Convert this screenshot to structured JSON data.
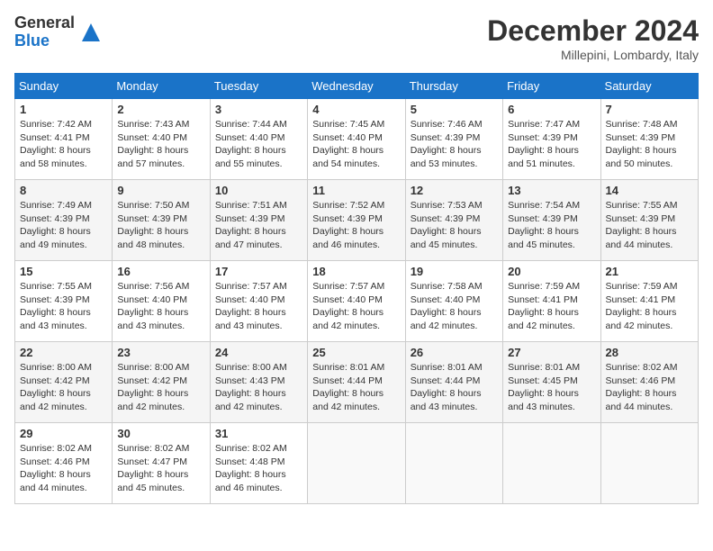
{
  "logo": {
    "general": "General",
    "blue": "Blue"
  },
  "title": "December 2024",
  "location": "Millepini, Lombardy, Italy",
  "days_of_week": [
    "Sunday",
    "Monday",
    "Tuesday",
    "Wednesday",
    "Thursday",
    "Friday",
    "Saturday"
  ],
  "weeks": [
    [
      {
        "day": "1",
        "sunrise": "7:42 AM",
        "sunset": "4:41 PM",
        "daylight": "8 hours and 58 minutes."
      },
      {
        "day": "2",
        "sunrise": "7:43 AM",
        "sunset": "4:40 PM",
        "daylight": "8 hours and 57 minutes."
      },
      {
        "day": "3",
        "sunrise": "7:44 AM",
        "sunset": "4:40 PM",
        "daylight": "8 hours and 55 minutes."
      },
      {
        "day": "4",
        "sunrise": "7:45 AM",
        "sunset": "4:40 PM",
        "daylight": "8 hours and 54 minutes."
      },
      {
        "day": "5",
        "sunrise": "7:46 AM",
        "sunset": "4:39 PM",
        "daylight": "8 hours and 53 minutes."
      },
      {
        "day": "6",
        "sunrise": "7:47 AM",
        "sunset": "4:39 PM",
        "daylight": "8 hours and 51 minutes."
      },
      {
        "day": "7",
        "sunrise": "7:48 AM",
        "sunset": "4:39 PM",
        "daylight": "8 hours and 50 minutes."
      }
    ],
    [
      {
        "day": "8",
        "sunrise": "7:49 AM",
        "sunset": "4:39 PM",
        "daylight": "8 hours and 49 minutes."
      },
      {
        "day": "9",
        "sunrise": "7:50 AM",
        "sunset": "4:39 PM",
        "daylight": "8 hours and 48 minutes."
      },
      {
        "day": "10",
        "sunrise": "7:51 AM",
        "sunset": "4:39 PM",
        "daylight": "8 hours and 47 minutes."
      },
      {
        "day": "11",
        "sunrise": "7:52 AM",
        "sunset": "4:39 PM",
        "daylight": "8 hours and 46 minutes."
      },
      {
        "day": "12",
        "sunrise": "7:53 AM",
        "sunset": "4:39 PM",
        "daylight": "8 hours and 45 minutes."
      },
      {
        "day": "13",
        "sunrise": "7:54 AM",
        "sunset": "4:39 PM",
        "daylight": "8 hours and 45 minutes."
      },
      {
        "day": "14",
        "sunrise": "7:55 AM",
        "sunset": "4:39 PM",
        "daylight": "8 hours and 44 minutes."
      }
    ],
    [
      {
        "day": "15",
        "sunrise": "7:55 AM",
        "sunset": "4:39 PM",
        "daylight": "8 hours and 43 minutes."
      },
      {
        "day": "16",
        "sunrise": "7:56 AM",
        "sunset": "4:40 PM",
        "daylight": "8 hours and 43 minutes."
      },
      {
        "day": "17",
        "sunrise": "7:57 AM",
        "sunset": "4:40 PM",
        "daylight": "8 hours and 43 minutes."
      },
      {
        "day": "18",
        "sunrise": "7:57 AM",
        "sunset": "4:40 PM",
        "daylight": "8 hours and 42 minutes."
      },
      {
        "day": "19",
        "sunrise": "7:58 AM",
        "sunset": "4:40 PM",
        "daylight": "8 hours and 42 minutes."
      },
      {
        "day": "20",
        "sunrise": "7:59 AM",
        "sunset": "4:41 PM",
        "daylight": "8 hours and 42 minutes."
      },
      {
        "day": "21",
        "sunrise": "7:59 AM",
        "sunset": "4:41 PM",
        "daylight": "8 hours and 42 minutes."
      }
    ],
    [
      {
        "day": "22",
        "sunrise": "8:00 AM",
        "sunset": "4:42 PM",
        "daylight": "8 hours and 42 minutes."
      },
      {
        "day": "23",
        "sunrise": "8:00 AM",
        "sunset": "4:42 PM",
        "daylight": "8 hours and 42 minutes."
      },
      {
        "day": "24",
        "sunrise": "8:00 AM",
        "sunset": "4:43 PM",
        "daylight": "8 hours and 42 minutes."
      },
      {
        "day": "25",
        "sunrise": "8:01 AM",
        "sunset": "4:44 PM",
        "daylight": "8 hours and 42 minutes."
      },
      {
        "day": "26",
        "sunrise": "8:01 AM",
        "sunset": "4:44 PM",
        "daylight": "8 hours and 43 minutes."
      },
      {
        "day": "27",
        "sunrise": "8:01 AM",
        "sunset": "4:45 PM",
        "daylight": "8 hours and 43 minutes."
      },
      {
        "day": "28",
        "sunrise": "8:02 AM",
        "sunset": "4:46 PM",
        "daylight": "8 hours and 44 minutes."
      }
    ],
    [
      {
        "day": "29",
        "sunrise": "8:02 AM",
        "sunset": "4:46 PM",
        "daylight": "8 hours and 44 minutes."
      },
      {
        "day": "30",
        "sunrise": "8:02 AM",
        "sunset": "4:47 PM",
        "daylight": "8 hours and 45 minutes."
      },
      {
        "day": "31",
        "sunrise": "8:02 AM",
        "sunset": "4:48 PM",
        "daylight": "8 hours and 46 minutes."
      },
      null,
      null,
      null,
      null
    ]
  ],
  "labels": {
    "sunrise": "Sunrise:",
    "sunset": "Sunset:",
    "daylight": "Daylight:"
  }
}
